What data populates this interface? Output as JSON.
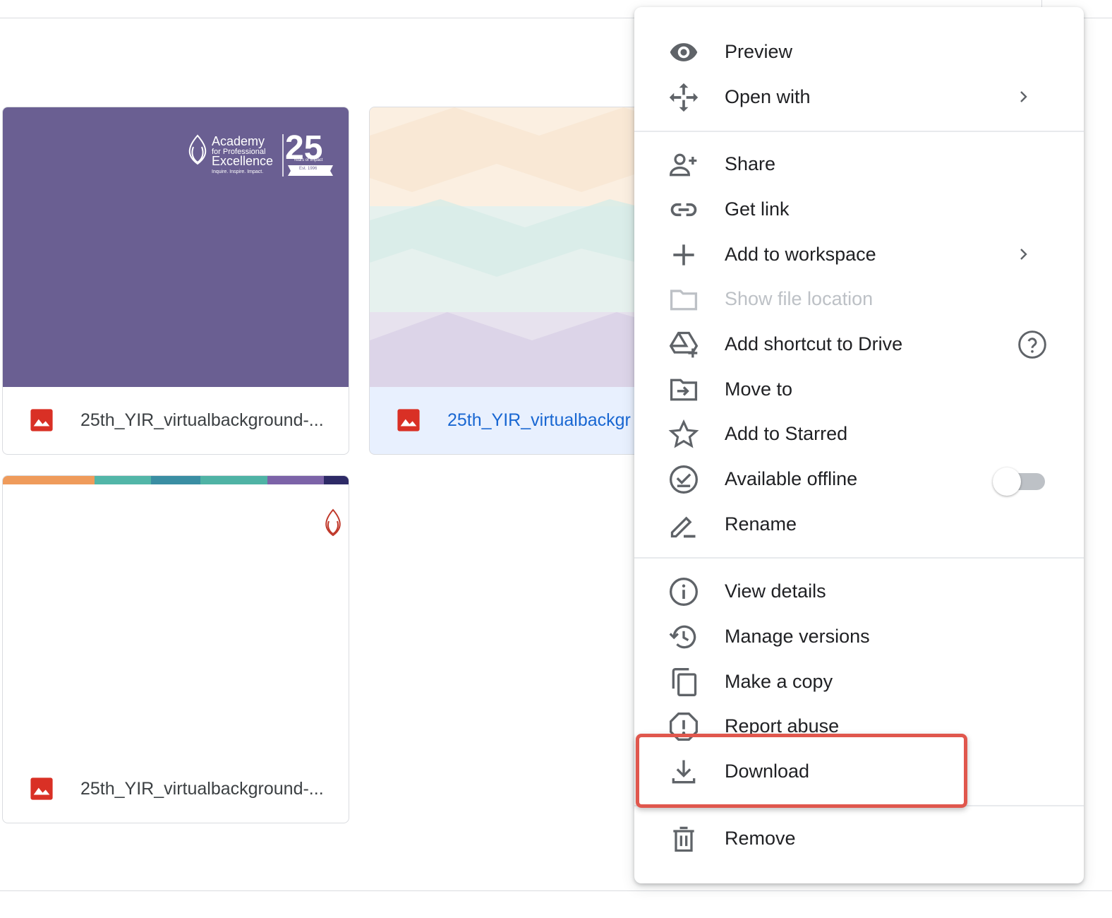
{
  "files": [
    {
      "name": "25th_YIR_virtualbackground-...",
      "selected": false
    },
    {
      "name": "25th_YIR_virtualbackgr",
      "selected": true
    },
    {
      "name": "25th_YIR_virtualbackground-...",
      "selected": false
    }
  ],
  "thumb1": {
    "logo_line1": "Academy",
    "logo_line2": "for Professional",
    "logo_line3": "Excellence",
    "tagline": "Inquire. Inspire. Impact.",
    "badge_number": "25",
    "badge_sub": "Years of Impact",
    "badge_est": "Est. 1996"
  },
  "menu": {
    "preview": "Preview",
    "open_with": "Open with",
    "share": "Share",
    "get_link": "Get link",
    "add_to_workspace": "Add to workspace",
    "show_file_location": "Show file location",
    "add_shortcut": "Add shortcut to Drive",
    "move_to": "Move to",
    "add_to_starred": "Add to Starred",
    "available_offline": "Available offline",
    "available_offline_enabled": false,
    "rename": "Rename",
    "view_details": "View details",
    "manage_versions": "Manage versions",
    "make_copy": "Make a copy",
    "report_abuse": "Report abuse",
    "download": "Download",
    "remove": "Remove"
  },
  "colors": {
    "highlight": "#e0574d",
    "selected_file_text": "#1967d2",
    "image_file_icon": "#d93025",
    "thumb_purple": "#6a5f92"
  }
}
